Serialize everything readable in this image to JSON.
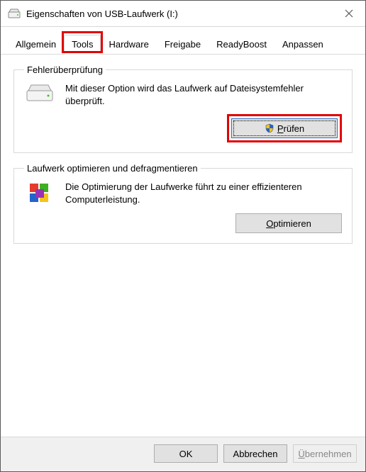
{
  "window": {
    "title": "Eigenschaften von USB-Laufwerk (I:)"
  },
  "tabs": {
    "allgemein": "Allgemein",
    "tools": "Tools",
    "hardware": "Hardware",
    "freigabe": "Freigabe",
    "readyboost": "ReadyBoost",
    "anpassen": "Anpassen"
  },
  "errorcheck": {
    "legend": "Fehlerüberprüfung",
    "text": "Mit dieser Option wird das Laufwerk auf Dateisystemfehler überprüft.",
    "button": "Prüfen"
  },
  "optimize": {
    "legend": "Laufwerk optimieren und defragmentieren",
    "text": "Die Optimierung der Laufwerke führt zu einer effizienteren Computerleistung.",
    "button": "Optimieren"
  },
  "footer": {
    "ok": "OK",
    "cancel": "Abbrechen",
    "apply": "Übernehmen"
  }
}
